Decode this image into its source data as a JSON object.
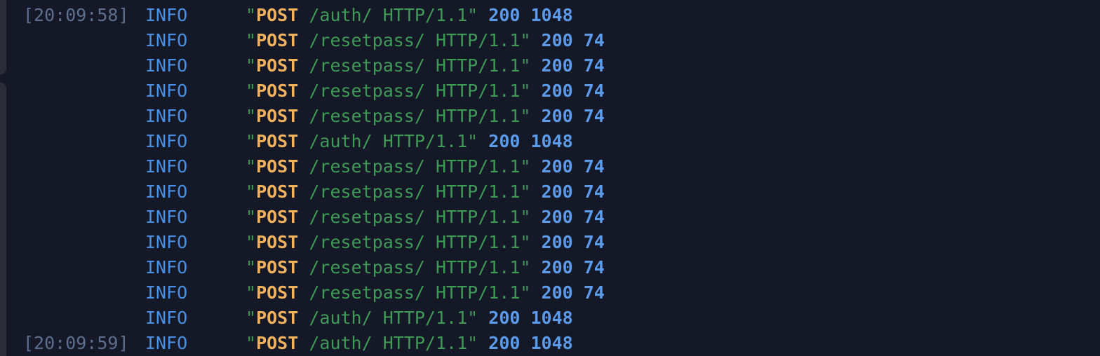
{
  "terminal": {
    "lines": [
      {
        "timestamp": "[20:09:58]",
        "level": "INFO",
        "method": "POST",
        "path": "/auth/",
        "protocol": "HTTP/1.1",
        "status": "200",
        "size": "1048"
      },
      {
        "timestamp": "",
        "level": "INFO",
        "method": "POST",
        "path": "/resetpass/",
        "protocol": "HTTP/1.1",
        "status": "200",
        "size": "74"
      },
      {
        "timestamp": "",
        "level": "INFO",
        "method": "POST",
        "path": "/resetpass/",
        "protocol": "HTTP/1.1",
        "status": "200",
        "size": "74"
      },
      {
        "timestamp": "",
        "level": "INFO",
        "method": "POST",
        "path": "/resetpass/",
        "protocol": "HTTP/1.1",
        "status": "200",
        "size": "74"
      },
      {
        "timestamp": "",
        "level": "INFO",
        "method": "POST",
        "path": "/resetpass/",
        "protocol": "HTTP/1.1",
        "status": "200",
        "size": "74"
      },
      {
        "timestamp": "",
        "level": "INFO",
        "method": "POST",
        "path": "/auth/",
        "protocol": "HTTP/1.1",
        "status": "200",
        "size": "1048"
      },
      {
        "timestamp": "",
        "level": "INFO",
        "method": "POST",
        "path": "/resetpass/",
        "protocol": "HTTP/1.1",
        "status": "200",
        "size": "74"
      },
      {
        "timestamp": "",
        "level": "INFO",
        "method": "POST",
        "path": "/resetpass/",
        "protocol": "HTTP/1.1",
        "status": "200",
        "size": "74"
      },
      {
        "timestamp": "",
        "level": "INFO",
        "method": "POST",
        "path": "/resetpass/",
        "protocol": "HTTP/1.1",
        "status": "200",
        "size": "74"
      },
      {
        "timestamp": "",
        "level": "INFO",
        "method": "POST",
        "path": "/resetpass/",
        "protocol": "HTTP/1.1",
        "status": "200",
        "size": "74"
      },
      {
        "timestamp": "",
        "level": "INFO",
        "method": "POST",
        "path": "/resetpass/",
        "protocol": "HTTP/1.1",
        "status": "200",
        "size": "74"
      },
      {
        "timestamp": "",
        "level": "INFO",
        "method": "POST",
        "path": "/resetpass/",
        "protocol": "HTTP/1.1",
        "status": "200",
        "size": "74"
      },
      {
        "timestamp": "",
        "level": "INFO",
        "method": "POST",
        "path": "/auth/",
        "protocol": "HTTP/1.1",
        "status": "200",
        "size": "1048"
      },
      {
        "timestamp": "[20:09:59]",
        "level": "INFO",
        "method": "POST",
        "path": "/auth/",
        "protocol": "HTTP/1.1",
        "status": "200",
        "size": "1048"
      }
    ]
  },
  "colors": {
    "background": "#151827",
    "timestamp": "#5e6f8d",
    "level_info": "#4a90e2",
    "request_text": "#3f9a56",
    "method": "#f2b15b",
    "status_and_size": "#5c9bea"
  }
}
